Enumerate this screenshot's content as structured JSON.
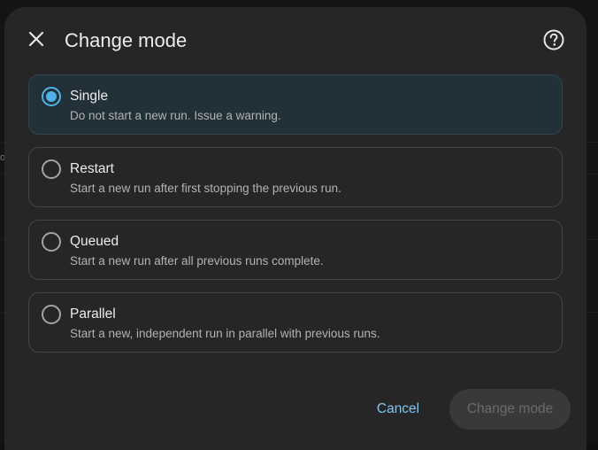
{
  "dialog": {
    "title": "Change mode",
    "close_icon": "close-icon",
    "help_icon": "help-circle-icon"
  },
  "background": {
    "left_fragment": "o"
  },
  "options": [
    {
      "label": "Single",
      "description": "Do not start a new run. Issue a warning.",
      "selected": true
    },
    {
      "label": "Restart",
      "description": "Start a new run after first stopping the previous run.",
      "selected": false
    },
    {
      "label": "Queued",
      "description": "Start a new run after all previous runs complete.",
      "selected": false
    },
    {
      "label": "Parallel",
      "description": "Start a new, independent run in parallel with previous runs.",
      "selected": false
    }
  ],
  "actions": {
    "cancel_label": "Cancel",
    "confirm_label": "Change mode",
    "confirm_disabled": true
  },
  "colors": {
    "accent": "#4fb3ea",
    "link": "#7cc7f4",
    "selected_bg": "#223038",
    "dialog_bg": "#262626"
  }
}
